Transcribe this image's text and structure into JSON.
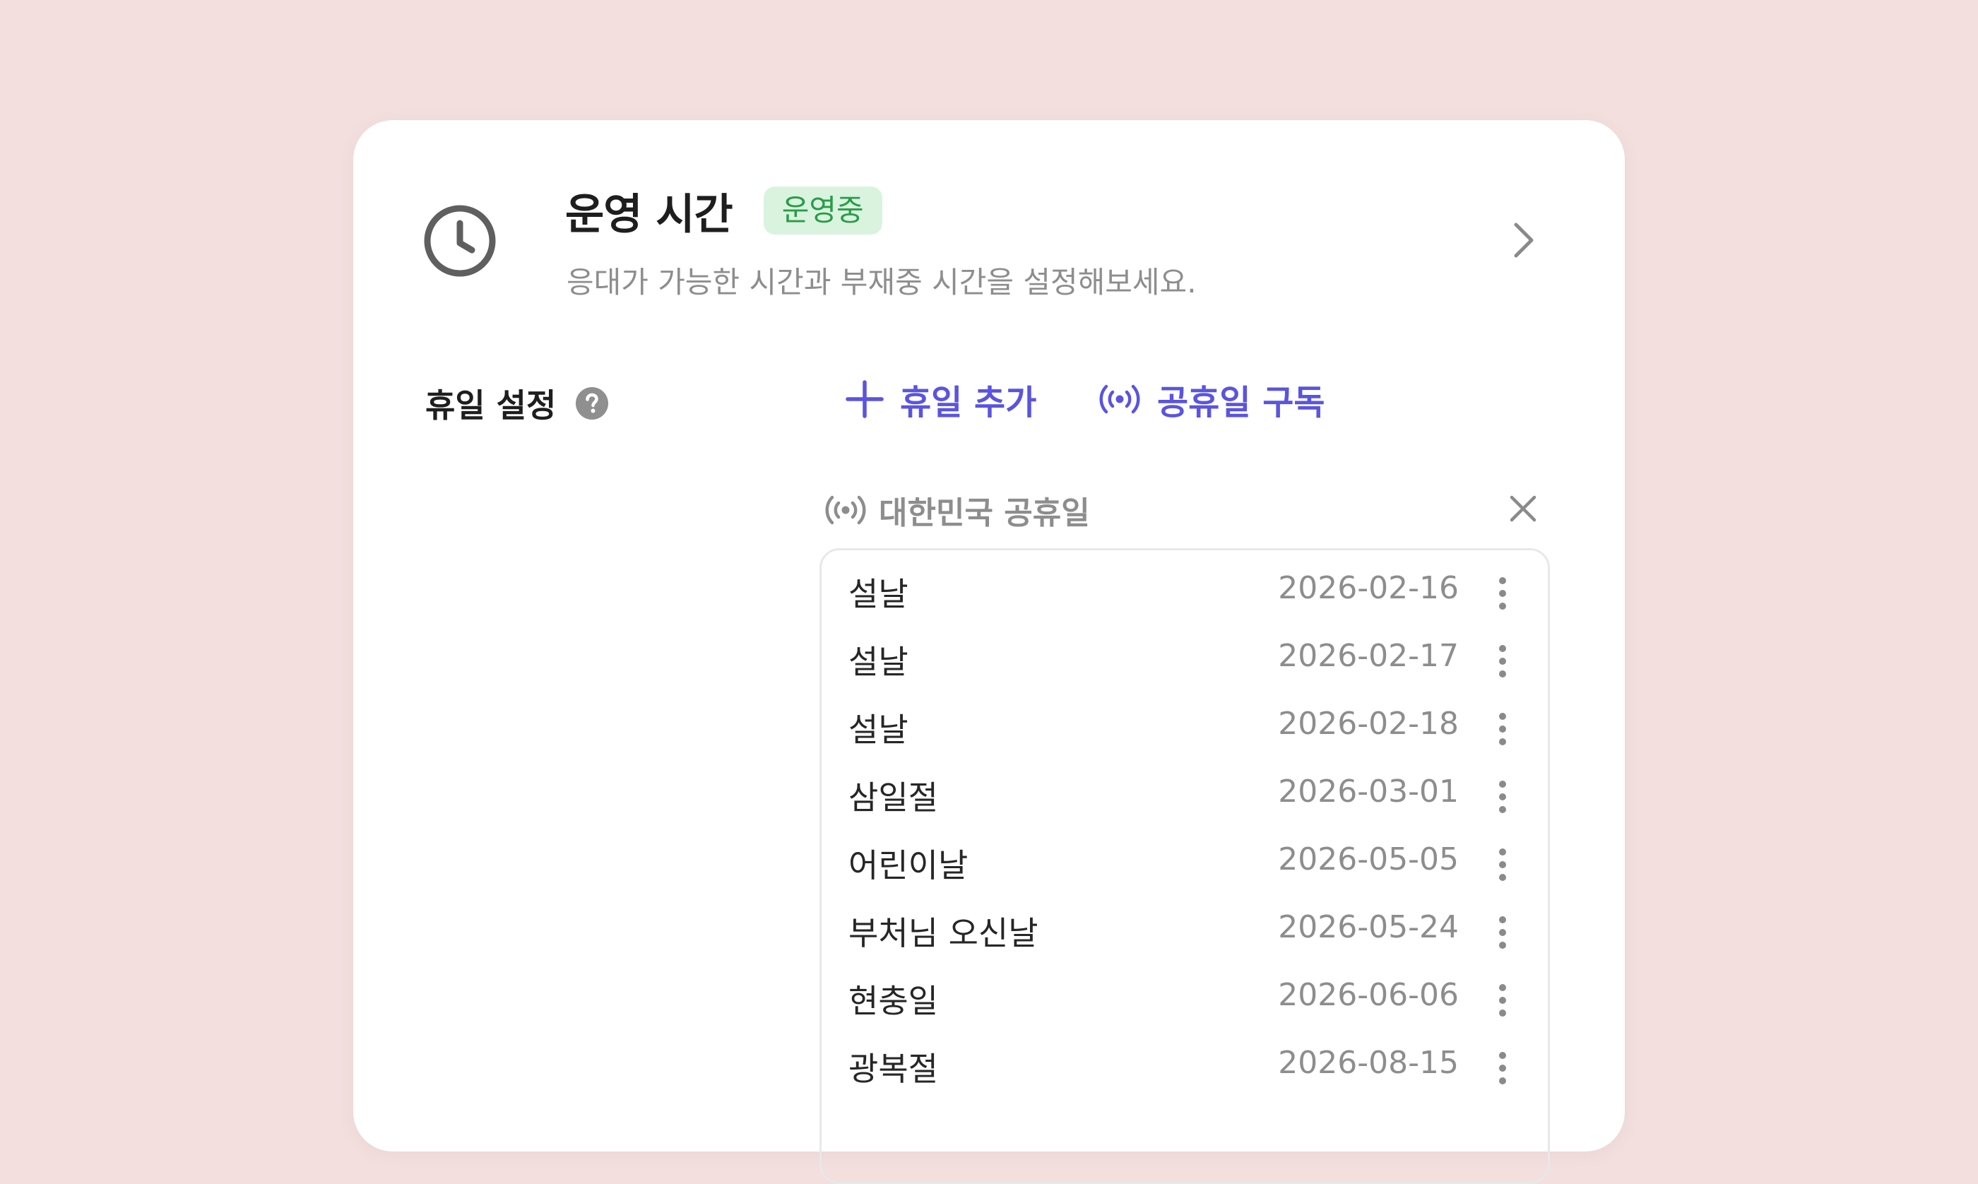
{
  "header": {
    "title": "운영 시간",
    "status_badge": "운영중",
    "subtitle": "응대가 가능한 시간과 부재중 시간을 설정해보세요."
  },
  "holiday_settings": {
    "label": "휴일 설정",
    "add_button": "휴일 추가",
    "subscribe_button": "공휴일 구독"
  },
  "subscription": {
    "name": "대한민국 공휴일",
    "holidays": [
      {
        "name": "설날",
        "date": "2026-02-16"
      },
      {
        "name": "설날",
        "date": "2026-02-17"
      },
      {
        "name": "설날",
        "date": "2026-02-18"
      },
      {
        "name": "삼일절",
        "date": "2026-03-01"
      },
      {
        "name": "어린이날",
        "date": "2026-05-05"
      },
      {
        "name": "부처님 오신날",
        "date": "2026-05-24"
      },
      {
        "name": "현충일",
        "date": "2026-06-06"
      },
      {
        "name": "광복절",
        "date": "2026-08-15"
      }
    ]
  },
  "colors": {
    "background": "#f2dfde",
    "accent": "#5a54e0",
    "badge_bg": "#d9f3df",
    "badge_text": "#2a9c47",
    "muted_text": "#8d8d8d"
  },
  "icons": {
    "clock": "clock-icon",
    "chevron": "chevron-right-icon",
    "help": "question-circle-icon",
    "add": "plus-icon",
    "broadcast": "broadcast-icon",
    "close": "close-icon",
    "more": "kebab-menu-icon"
  }
}
